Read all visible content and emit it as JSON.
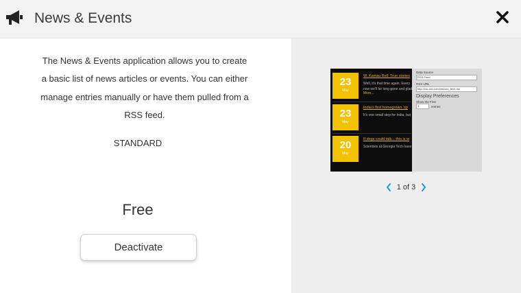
{
  "header": {
    "title": "News & Events",
    "icons": {
      "app": "megaphone-icon",
      "close": "close-icon"
    }
  },
  "details": {
    "description": "The News & Events application allows you to create a basic list of news articles or events. You can either manage entries manually or have them pulled from a RSS feed.",
    "tier": "STANDARD",
    "price": "Free",
    "action_label": "Deactivate"
  },
  "preview": {
    "news_items": [
      {
        "day": "23",
        "month": "May",
        "headline": "W. Kamau Bell: True stories",
        "snippet": "Well, it's that time again. Every now we'll be long gone and glad",
        "more": "More..."
      },
      {
        "day": "23",
        "month": "May",
        "headline": "India's first homegrown 'sp",
        "snippet": "It's one small step for India, but",
        "more": ""
      },
      {
        "day": "20",
        "month": "May",
        "headline": "If dogs could talk... this is w",
        "snippet": "Scientists at Georgia Tech have",
        "more": ""
      }
    ],
    "settings": {
      "data_source_label": "Data Source",
      "data_source_value": "RSS Feed",
      "rss_url_label": "RSS URL",
      "rss_url_value": "http://rss.cnn.com/rss/cnn_tech.rss",
      "section_title": "Display Preferences",
      "show_first_label": "Show the First",
      "show_first_value": "3",
      "entries_label": "entries"
    }
  },
  "pager": {
    "text": "1 of 3",
    "icons": {
      "prev": "chevron-left-icon",
      "next": "chevron-right-icon"
    }
  },
  "colors": {
    "accent": "#1a9ad6",
    "date_tile": "#f2c200",
    "header_bg": "#f3f3f3",
    "panel_bg": "#eeeeee"
  }
}
